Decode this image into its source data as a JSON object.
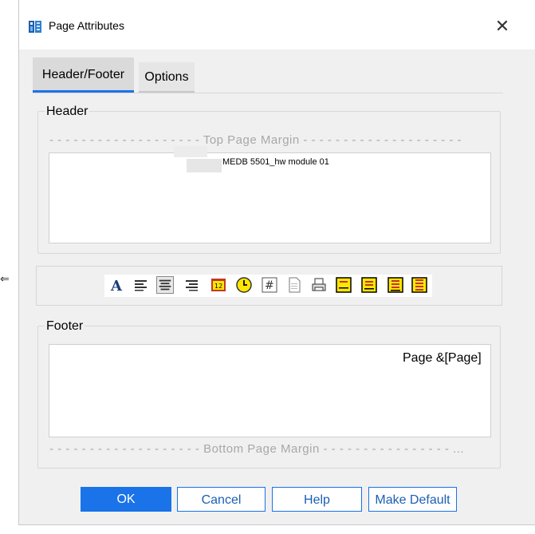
{
  "dialog": {
    "title": "Page Attributes",
    "close_glyph": "✕"
  },
  "edge_glyph": "⇐",
  "tabs": [
    {
      "label": "Header/Footer",
      "active": true
    },
    {
      "label": "Options",
      "active": false
    }
  ],
  "header": {
    "group_label": "Header",
    "margin_label": "- - - - - - - - - - - - - - - - - - - Top Page Margin - - - - - - - - - - - - - - - - - - - -",
    "text": "MEDB 5501_hw module 01"
  },
  "toolbar": {
    "buttons": [
      {
        "name": "font-icon",
        "glyph": "A"
      },
      {
        "name": "align-left-icon"
      },
      {
        "name": "align-center-icon"
      },
      {
        "name": "align-right-icon"
      },
      {
        "name": "date-icon"
      },
      {
        "name": "time-icon"
      },
      {
        "name": "page-number-icon",
        "glyph": "#"
      },
      {
        "name": "file-name-icon"
      },
      {
        "name": "printer-icon"
      },
      {
        "name": "field-icon-1"
      },
      {
        "name": "field-icon-2"
      },
      {
        "name": "field-icon-3"
      },
      {
        "name": "field-icon-4"
      }
    ]
  },
  "footer": {
    "group_label": "Footer",
    "text": "Page &[Page]",
    "margin_label": "- - - - - - - - - - - - - - - - - - - Bottom Page Margin - - - - - - - - - - - - - - - - ..."
  },
  "buttons": {
    "ok": "OK",
    "cancel": "Cancel",
    "help": "Help",
    "make_default": "Make Default"
  },
  "colors": {
    "accent": "#1a73e8",
    "panel_bg": "#f0f0f0",
    "margin_text": "#a8a8a8",
    "tool_yellow": "#ffe600"
  }
}
